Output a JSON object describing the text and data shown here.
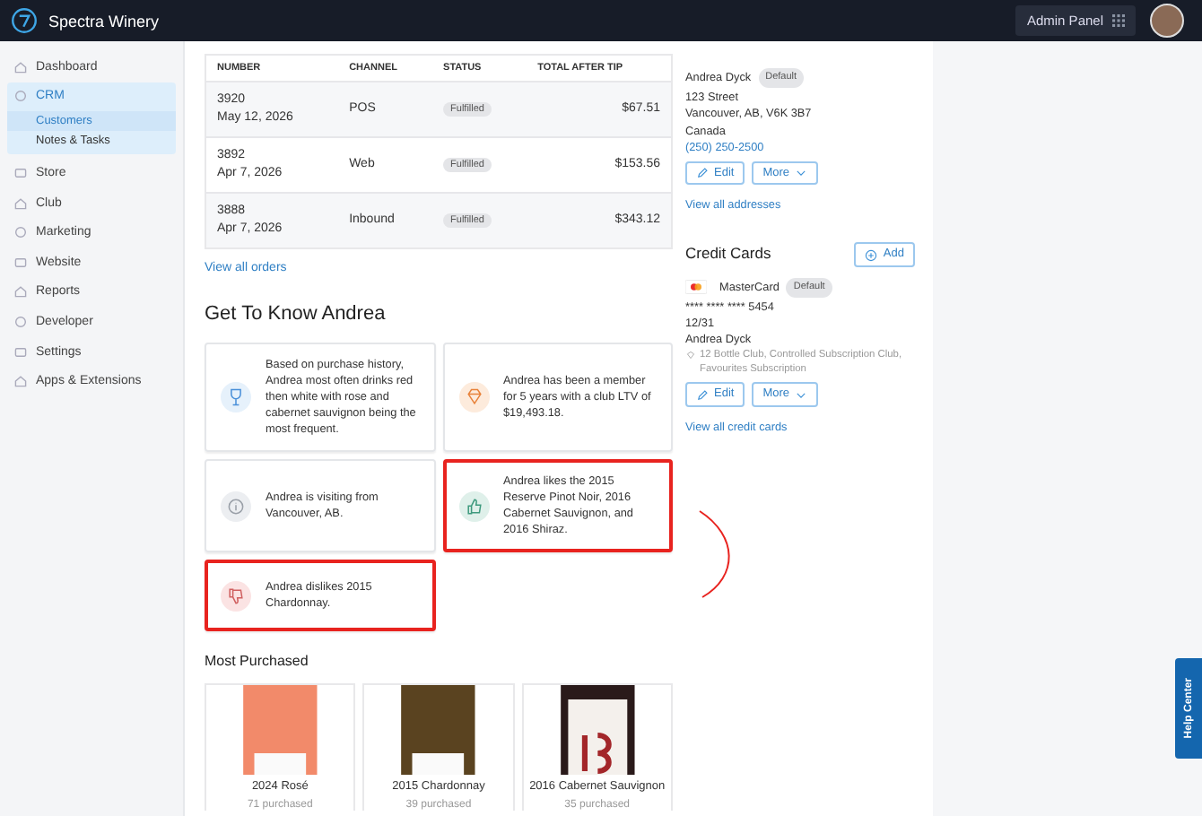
{
  "topbar": {
    "brand": "Spectra Winery",
    "admin_panel": "Admin Panel"
  },
  "sidebar": {
    "items": [
      {
        "label": "Dashboard",
        "expanded": false
      },
      {
        "label": "CRM",
        "expanded": true,
        "children": [
          {
            "label": "Customers",
            "selected": true
          },
          {
            "label": "Notes & Tasks",
            "selected": false
          }
        ]
      },
      {
        "label": "Store",
        "expanded": false
      },
      {
        "label": "Club",
        "expanded": false
      },
      {
        "label": "Marketing",
        "expanded": false
      },
      {
        "label": "Website",
        "expanded": false
      },
      {
        "label": "Reports",
        "expanded": false
      },
      {
        "label": "Developer",
        "expanded": false
      },
      {
        "label": "Settings",
        "expanded": false
      },
      {
        "label": "Apps & Extensions",
        "expanded": false
      }
    ]
  },
  "orders": {
    "columns": [
      "NUMBER",
      "CHANNEL",
      "STATUS",
      "TOTAL AFTER TIP"
    ],
    "rows": [
      {
        "number": "3920",
        "date": "May 12, 2026",
        "channel": "POS",
        "status": "Fulfilled",
        "total": "$67.51"
      },
      {
        "number": "3892",
        "date": "Apr 7, 2026",
        "channel": "Web",
        "status": "Fulfilled",
        "total": "$153.56"
      },
      {
        "number": "3888",
        "date": "Apr 7, 2026",
        "channel": "Inbound",
        "status": "Fulfilled",
        "total": "$343.12"
      }
    ],
    "link": "View all orders"
  },
  "insights": {
    "title": "Get To Know Andrea",
    "items": [
      {
        "kind": "wine",
        "text": "Based on purchase history, Andrea most often drinks red then white with rose and cabernet sauvignon being the most frequent.",
        "highlighted": false
      },
      {
        "kind": "gem",
        "text": "Andrea has been a member for 5 years with a club LTV of $19,493.18.",
        "highlighted": false
      },
      {
        "kind": "info",
        "text": "Andrea is visiting from Vancouver, AB.",
        "highlighted": false
      },
      {
        "kind": "like",
        "text": "Andrea likes the 2015 Reserve Pinot Noir, 2016 Cabernet Sauvignon, and 2016 Shiraz.",
        "highlighted": true
      },
      {
        "kind": "dislike",
        "text": "Andrea dislikes 2015 Chardonnay.",
        "highlighted": true
      }
    ]
  },
  "most_purchased": {
    "title": "Most Purchased",
    "items": [
      {
        "kind": "rose",
        "name": "2024 Rosé",
        "count": "71 purchased"
      },
      {
        "kind": "white",
        "name": "2015 Chardonnay",
        "count": "39 purchased"
      },
      {
        "kind": "red",
        "name": "2016 Cabernet Sauvignon",
        "count": "35 purchased"
      }
    ]
  },
  "address": {
    "name": "Andrea Dyck",
    "badge": "Default",
    "lines": [
      "123 Street",
      "Vancouver, AB, V6K 3B7",
      "Canada"
    ],
    "phone": "(250) 250-2500",
    "edit": "Edit",
    "more": "More",
    "link": "View all addresses"
  },
  "credit_cards": {
    "title": "Credit Cards",
    "add": "Add",
    "brand": "MasterCard",
    "badge": "Default",
    "number": "**** **** **** 5454",
    "expiry": "12/31",
    "holder": "Andrea Dyck",
    "clubs": "12 Bottle Club, Controlled Subscription Club, Favourites Subscription",
    "edit": "Edit",
    "more": "More",
    "link": "View all credit cards"
  },
  "help": "Help Center"
}
